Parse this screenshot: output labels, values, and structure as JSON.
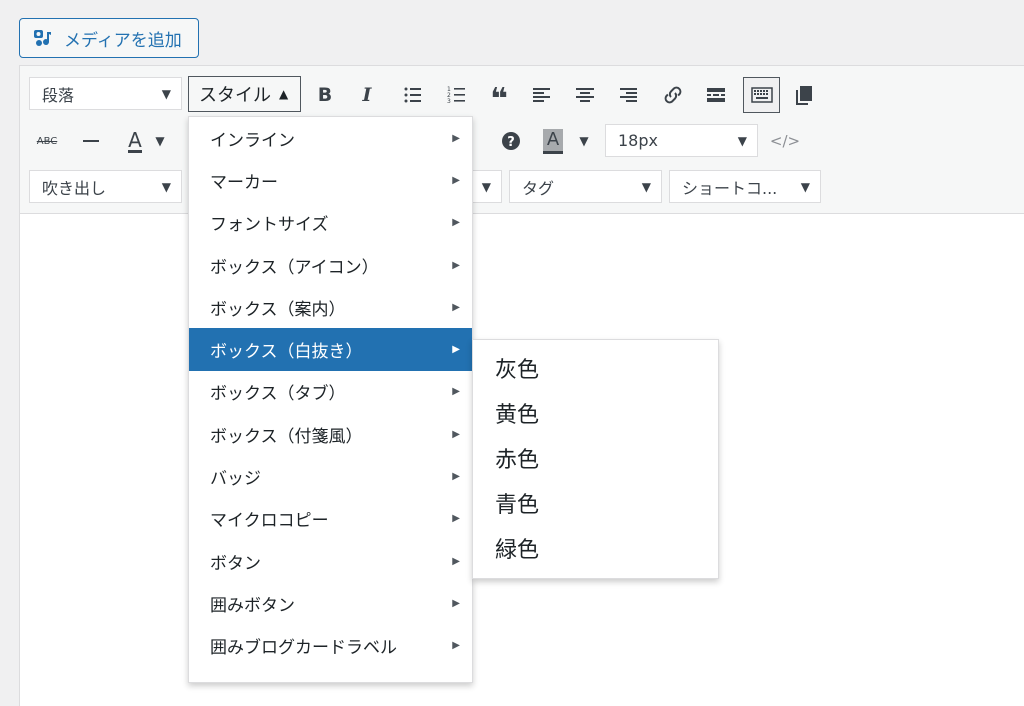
{
  "media_button": {
    "label": "メディアを追加"
  },
  "toolbar": {
    "row1": {
      "format_select": "段落",
      "styles_label": "スタイル"
    },
    "row2": {
      "font_size": "18px"
    },
    "row3": {
      "callout_select": "吹き出し",
      "tag_select": "タグ",
      "shortcode_select": "ショートコ..."
    }
  },
  "styles_menu": {
    "items": [
      {
        "label": "インライン"
      },
      {
        "label": "マーカー"
      },
      {
        "label": "フォントサイズ"
      },
      {
        "label": "ボックス（アイコン）"
      },
      {
        "label": "ボックス（案内）"
      },
      {
        "label": "ボックス（白抜き）"
      },
      {
        "label": "ボックス（タブ）"
      },
      {
        "label": "ボックス（付箋風）"
      },
      {
        "label": "バッジ"
      },
      {
        "label": "マイクロコピー"
      },
      {
        "label": "ボタン"
      },
      {
        "label": "囲みボタン"
      },
      {
        "label": "囲みブログカードラベル"
      }
    ],
    "active_item": "ボックス（白抜き）"
  },
  "submenu": {
    "items": [
      {
        "label": "灰色"
      },
      {
        "label": "黄色"
      },
      {
        "label": "赤色"
      },
      {
        "label": "青色"
      },
      {
        "label": "緑色"
      }
    ]
  },
  "colors": {
    "accent": "#2271b1",
    "toolbar_bg": "#f6f7f7",
    "page_bg": "#f0f0f1"
  }
}
